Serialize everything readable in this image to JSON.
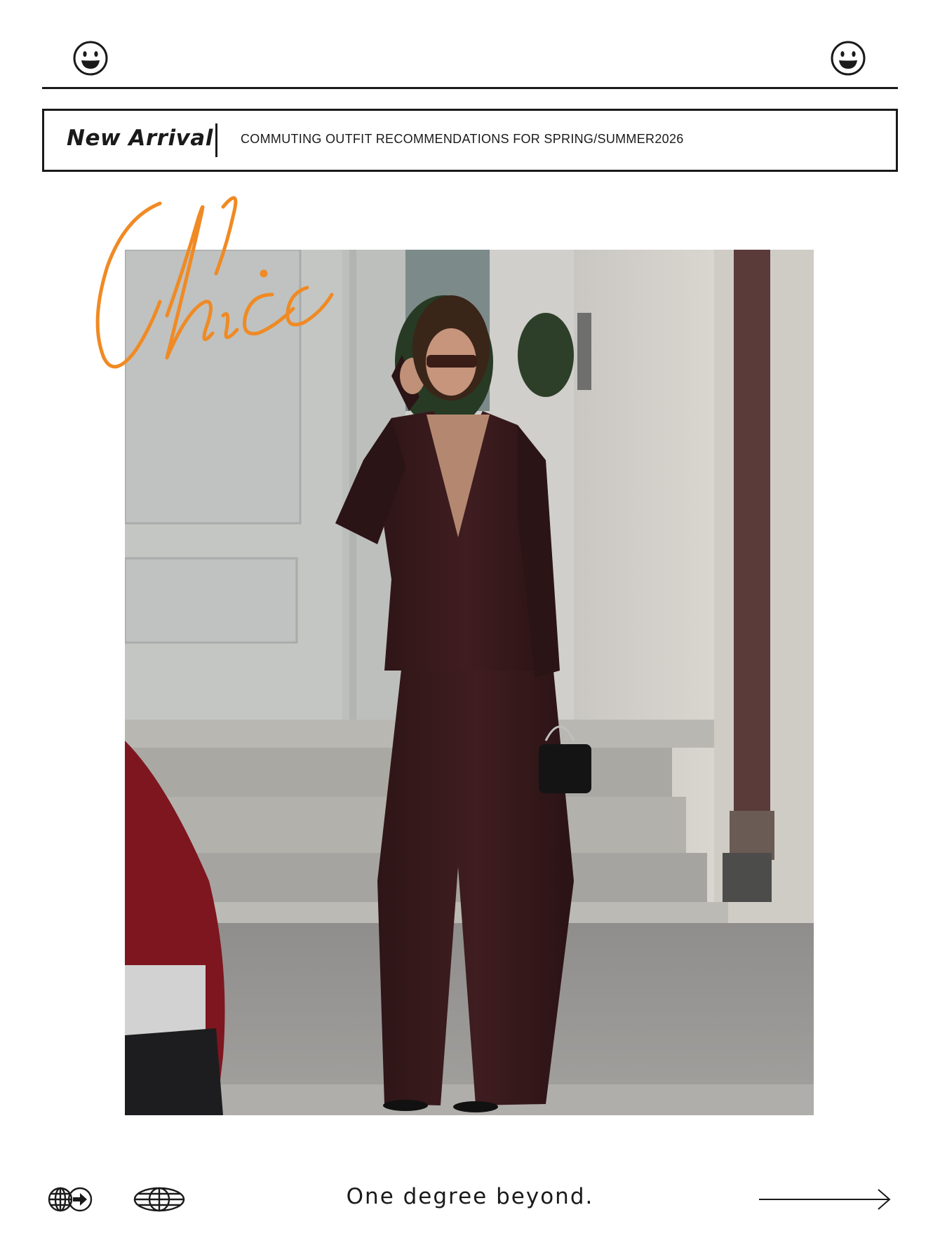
{
  "header": {
    "left_icon": "smiley-face-icon",
    "right_icon": "smiley-face-icon"
  },
  "banner": {
    "title": "New Arrival",
    "subtitle": "COMMUTING OUTFIT RECOMMENDATIONS FOR SPRING/SUMMER2026"
  },
  "hero": {
    "script_word": "Chic",
    "script_color": "#f08a24",
    "photo": "woman-in-burgundy-suit-photo"
  },
  "footer": {
    "icons": [
      "globe-arrow-icon",
      "globe-icon",
      "long-arrow-right-icon"
    ],
    "tagline": "One degree beyond."
  },
  "colors": {
    "ink": "#1a1a1a",
    "accent": "#f08a24",
    "suit": "#3a1a1c"
  }
}
